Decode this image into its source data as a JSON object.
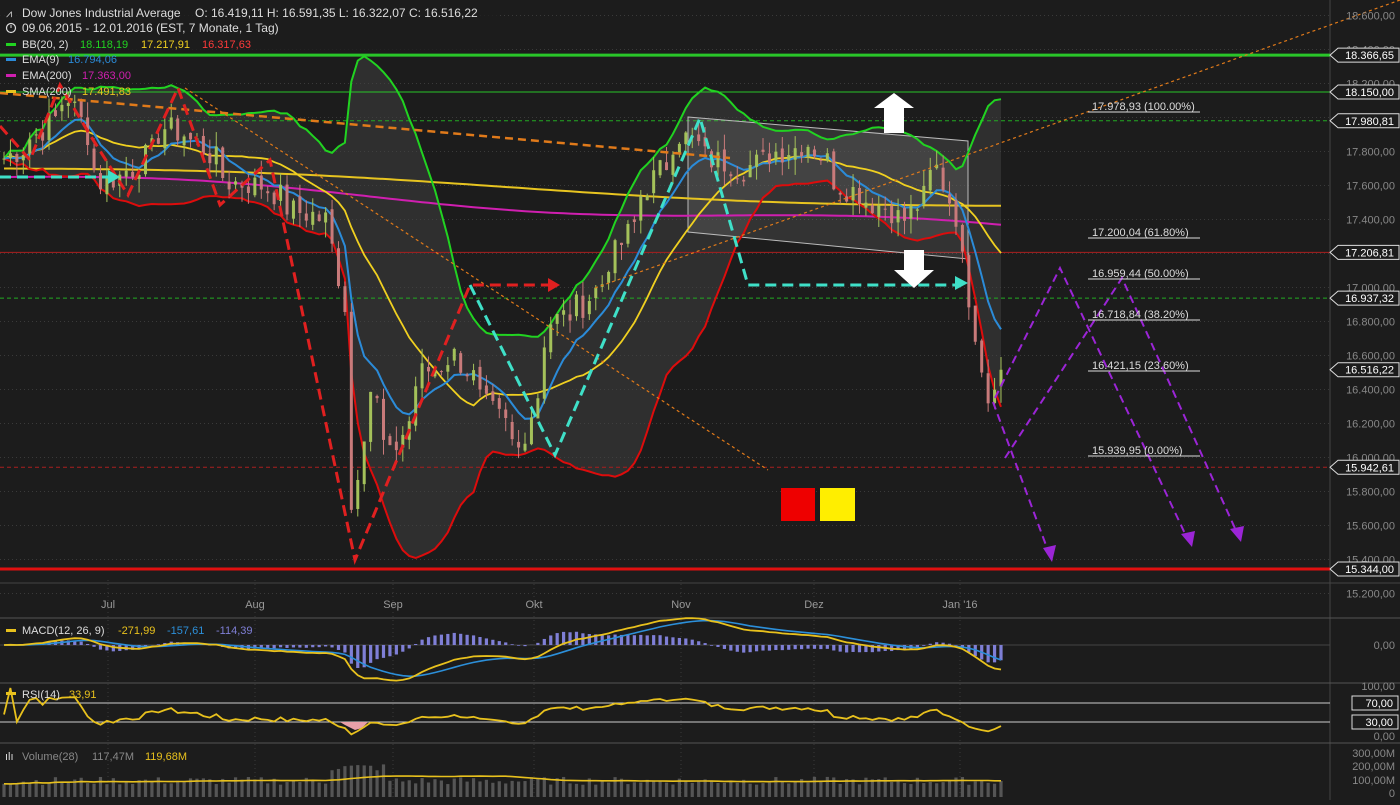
{
  "header": {
    "title": "Dow Jones Industrial Average",
    "ohlc": "O: 16.419,11  H: 16.591,35  L: 16.322,07  C: 16.516,22",
    "range": "09.06.2015 - 12.01.2016 (EST, 7 Monate, 1 Tag)",
    "icon": "clock-icon"
  },
  "legend": {
    "bb_label": "BB(20, 2)",
    "bb_upper": "18.118,19",
    "bb_mid": "17.217,91",
    "bb_lower": "16.317,63",
    "ema9_label": "EMA(9)",
    "ema9_value": "16.794,06",
    "ema200_label": "EMA(200)",
    "ema200_value": "17.363,00",
    "sma200_label": "SMA(200)",
    "sma200_value": "17.491,83"
  },
  "colors": {
    "background": "#1c1c1c",
    "grid": "#3a3a3a",
    "axis_text": "#888888",
    "bull": "#a4c15a",
    "bear": "#c87a7a",
    "bb_upper": "#21d321",
    "bb_lower": "#dd0c0c",
    "ema9": "#2b8bd8",
    "ema200": "#d01fb0",
    "sma200": "#e7c420",
    "bb_mid": "#f0d020",
    "hline_green": "#29c529",
    "hline_red": "#e01010",
    "fib_green": "#22aa22",
    "fib_red": "#aa1f1f",
    "dash_red": "#e02020",
    "dash_cyan": "#3fe0c8",
    "dash_purple": "#9b25d6",
    "dash_orange": "#e07a1a",
    "macd_hist": "#7f7fd6",
    "macd_line": "#e8c11d",
    "macd_signal": "#2c8fd9",
    "volume_bar": "#555555"
  },
  "price_axis": {
    "labels": [
      "18.600,00",
      "18.400,00",
      "18.200,00",
      "18.000,00",
      "17.800,00",
      "17.600,00",
      "17.400,00",
      "17.200,00",
      "17.000,00",
      "16.800,00",
      "16.600,00",
      "16.400,00",
      "16.200,00",
      "16.000,00",
      "15.800,00",
      "15.600,00",
      "15.400,00",
      "15.200,00"
    ],
    "tags": [
      "18.366,65",
      "18.150,00",
      "17.980,81",
      "17.206,81",
      "16.937,32",
      "16.516,22",
      "15.942,61",
      "15.344,00"
    ]
  },
  "fibonacci": [
    {
      "label": "17.978,93 (100.00%)"
    },
    {
      "label": "17.200,04 (61.80%)"
    },
    {
      "label": "16.959,44 (50.00%)"
    },
    {
      "label": "16.718,84 (38.20%)"
    },
    {
      "label": "16.421,15 (23.60%)"
    },
    {
      "label": "15.939,95 (0.00%)"
    }
  ],
  "months": [
    "Jul",
    "Aug",
    "Sep",
    "Okt",
    "Nov",
    "Dez",
    "Jan '16"
  ],
  "macd": {
    "label": "MACD(12, 26, 9)",
    "v1": "-271,99",
    "v2": "-157,61",
    "v3": "-114,39",
    "axis": "0,00"
  },
  "rsi": {
    "label": "RSI(14)",
    "value": "33,91",
    "axis_top": "100,00",
    "axis_bottom": "0,00",
    "upper_tag": "70,00",
    "lower_tag": "30,00"
  },
  "volume": {
    "label": "Volume(28)",
    "v1": "117,47M",
    "v2": "119,68M",
    "axis": [
      "300,00M",
      "200,00M",
      "100,00M",
      "0"
    ]
  },
  "chart_data": {
    "type": "candlestick",
    "title": "Dow Jones Industrial Average",
    "period": "09.06.2015 - 12.01.2016",
    "ylim": [
      15100,
      18700
    ],
    "last_candle": {
      "open": 16419.11,
      "high": 16591.35,
      "low": 16322.07,
      "close": 16516.22
    },
    "horizontal_levels": [
      18366.65,
      18150.0,
      17980.81,
      17206.81,
      16937.32,
      15942.61,
      15344.0
    ],
    "fib_levels": [
      17978.93,
      17200.04,
      16959.44,
      16718.84,
      16421.15,
      15939.95
    ],
    "indicators": {
      "bb_upper": 18118.19,
      "bb_mid": 17217.91,
      "bb_lower": 16317.63,
      "ema9": 16794.06,
      "ema200": 17363.0,
      "sma200": 17491.83,
      "macd": -271.99,
      "macd_signal": -157.61,
      "macd_hist": -114.39,
      "rsi": 33.91,
      "volume_avg": "117,47M",
      "volume": "119,68M"
    },
    "close_path": [
      [
        "2015-06-09",
        17760
      ],
      [
        "2015-06-16",
        17900
      ],
      [
        "2015-06-23",
        18120
      ],
      [
        "2015-06-30",
        17620
      ],
      [
        "2015-07-07",
        17700
      ],
      [
        "2015-07-14",
        17940
      ],
      [
        "2015-07-21",
        17850
      ],
      [
        "2015-07-28",
        17620
      ],
      [
        "2015-08-04",
        17600
      ],
      [
        "2015-08-11",
        17450
      ],
      [
        "2015-08-18",
        17400
      ],
      [
        "2015-08-21",
        16900
      ],
      [
        "2015-08-24",
        15700
      ],
      [
        "2015-08-27",
        16400
      ],
      [
        "2015-09-01",
        16000
      ],
      [
        "2015-09-08",
        16500
      ],
      [
        "2015-09-15",
        16600
      ],
      [
        "2015-09-22",
        16300
      ],
      [
        "2015-09-29",
        16050
      ],
      [
        "2015-10-06",
        16800
      ],
      [
        "2015-10-13",
        16900
      ],
      [
        "2015-10-20",
        17200
      ],
      [
        "2015-10-27",
        17600
      ],
      [
        "2015-11-03",
        17900
      ],
      [
        "2015-11-10",
        17750
      ],
      [
        "2015-11-17",
        17700
      ],
      [
        "2015-11-24",
        17800
      ],
      [
        "2015-12-01",
        17850
      ],
      [
        "2015-12-08",
        17600
      ],
      [
        "2015-12-15",
        17500
      ],
      [
        "2015-12-22",
        17400
      ],
      [
        "2015-12-29",
        17700
      ],
      [
        "2016-01-04",
        17150
      ],
      [
        "2016-01-08",
        16350
      ],
      [
        "2016-01-12",
        16516
      ]
    ]
  }
}
